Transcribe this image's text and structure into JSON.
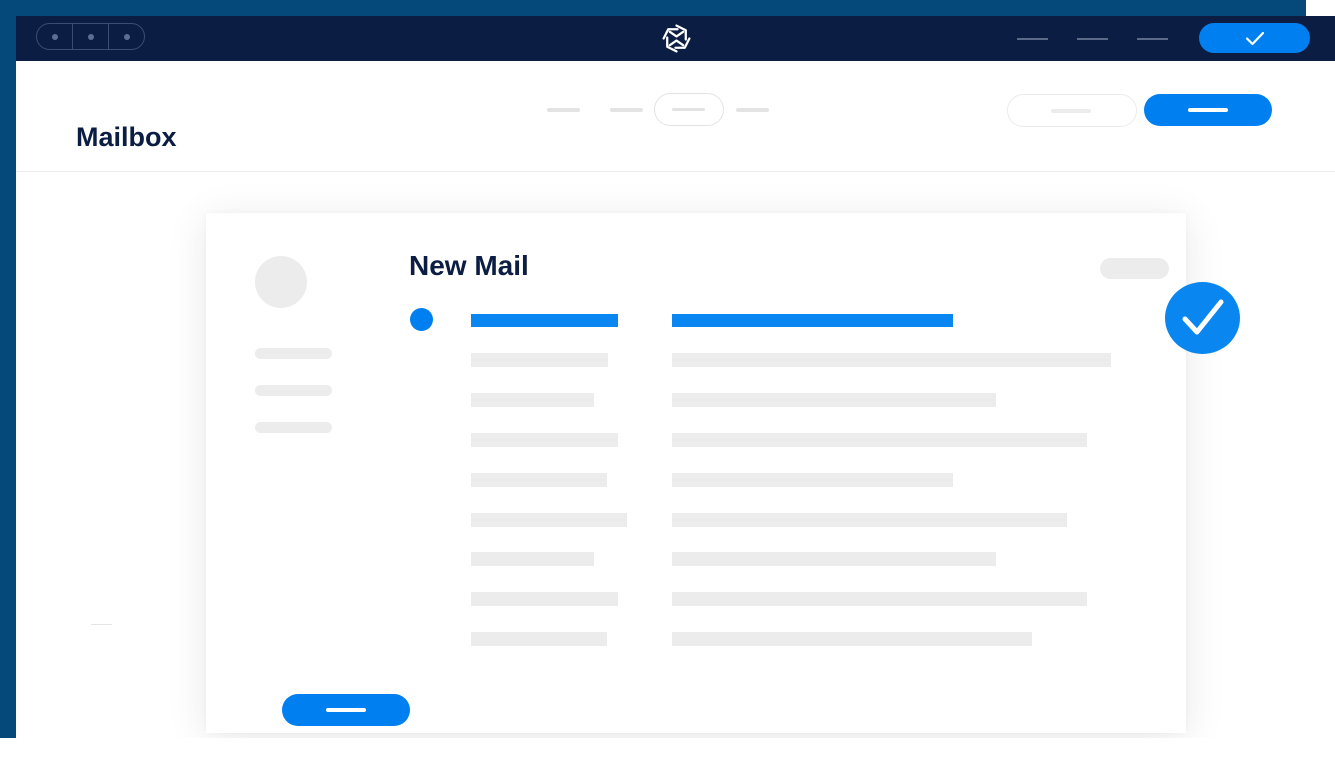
{
  "window": {
    "controls": [
      "window-control-1",
      "window-control-2",
      "window-control-3"
    ],
    "logo_icon": "brand-logo-icon"
  },
  "topbar": {
    "nav_items": [
      "nav-item-1",
      "nav-item-2",
      "nav-item-3"
    ],
    "cta_icon": "checkmark-icon"
  },
  "header": {
    "title": "Mailbox",
    "tabs": [
      "tab-1",
      "tab-2",
      "tab-3",
      "tab-4"
    ],
    "active_tab_index": 2
  },
  "card": {
    "title": "New Mail",
    "rows_total": 9,
    "active_row_index": 0
  },
  "colors": {
    "brand_navy": "#0b1d42",
    "backdrop_blue": "#05487a",
    "accent_blue": "#0080f0",
    "placeholder_gray": "#ececec",
    "white": "#ffffff"
  },
  "badge": {
    "icon": "checkmark-icon",
    "state": "sent"
  }
}
